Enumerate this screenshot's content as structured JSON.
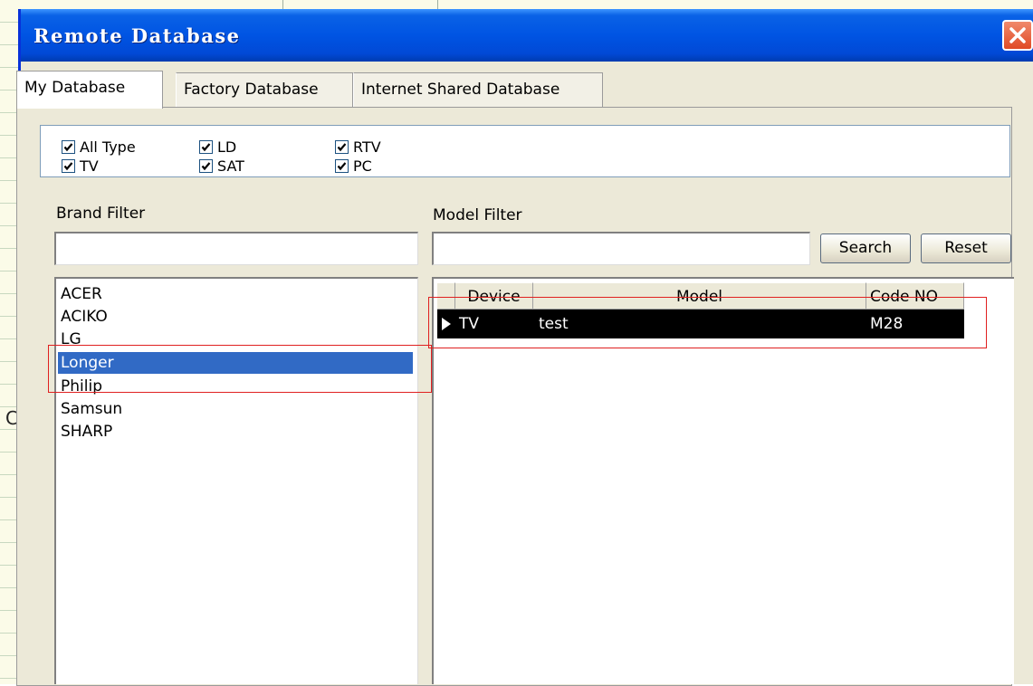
{
  "dialog": {
    "title": "Remote Database",
    "close_icon": "close-icon",
    "colors": {
      "titlebar": "#0054e3",
      "close": "#e04a25",
      "selection": "#316ac5",
      "highlight_outline": "#e02020"
    }
  },
  "tabs": [
    {
      "label": "My Database",
      "active": true
    },
    {
      "label": "Factory Database",
      "active": false
    },
    {
      "label": "Internet Shared Database",
      "active": false
    }
  ],
  "types": [
    {
      "label": "All Type",
      "checked": true
    },
    {
      "label": "TV",
      "checked": true
    },
    {
      "label": "LD",
      "checked": true
    },
    {
      "label": "SAT",
      "checked": true
    },
    {
      "label": "RTV",
      "checked": true
    },
    {
      "label": "PC",
      "checked": true
    }
  ],
  "brand_filter": {
    "label": "Brand Filter",
    "value": ""
  },
  "model_filter": {
    "label": "Model Filter",
    "value": ""
  },
  "buttons": {
    "search": "Search",
    "reset": "Reset"
  },
  "brands": [
    "ACER",
    "ACIKO",
    "LG",
    "Longer",
    "Philip",
    "Samsun",
    "SHARP"
  ],
  "selected_brand": "Longer",
  "grid": {
    "columns": [
      "Device",
      "Model",
      "Code NO"
    ],
    "rows": [
      {
        "device": "TV",
        "model": "test",
        "code": "M28",
        "selected": true
      }
    ]
  },
  "background": {
    "cell_text": "C"
  }
}
